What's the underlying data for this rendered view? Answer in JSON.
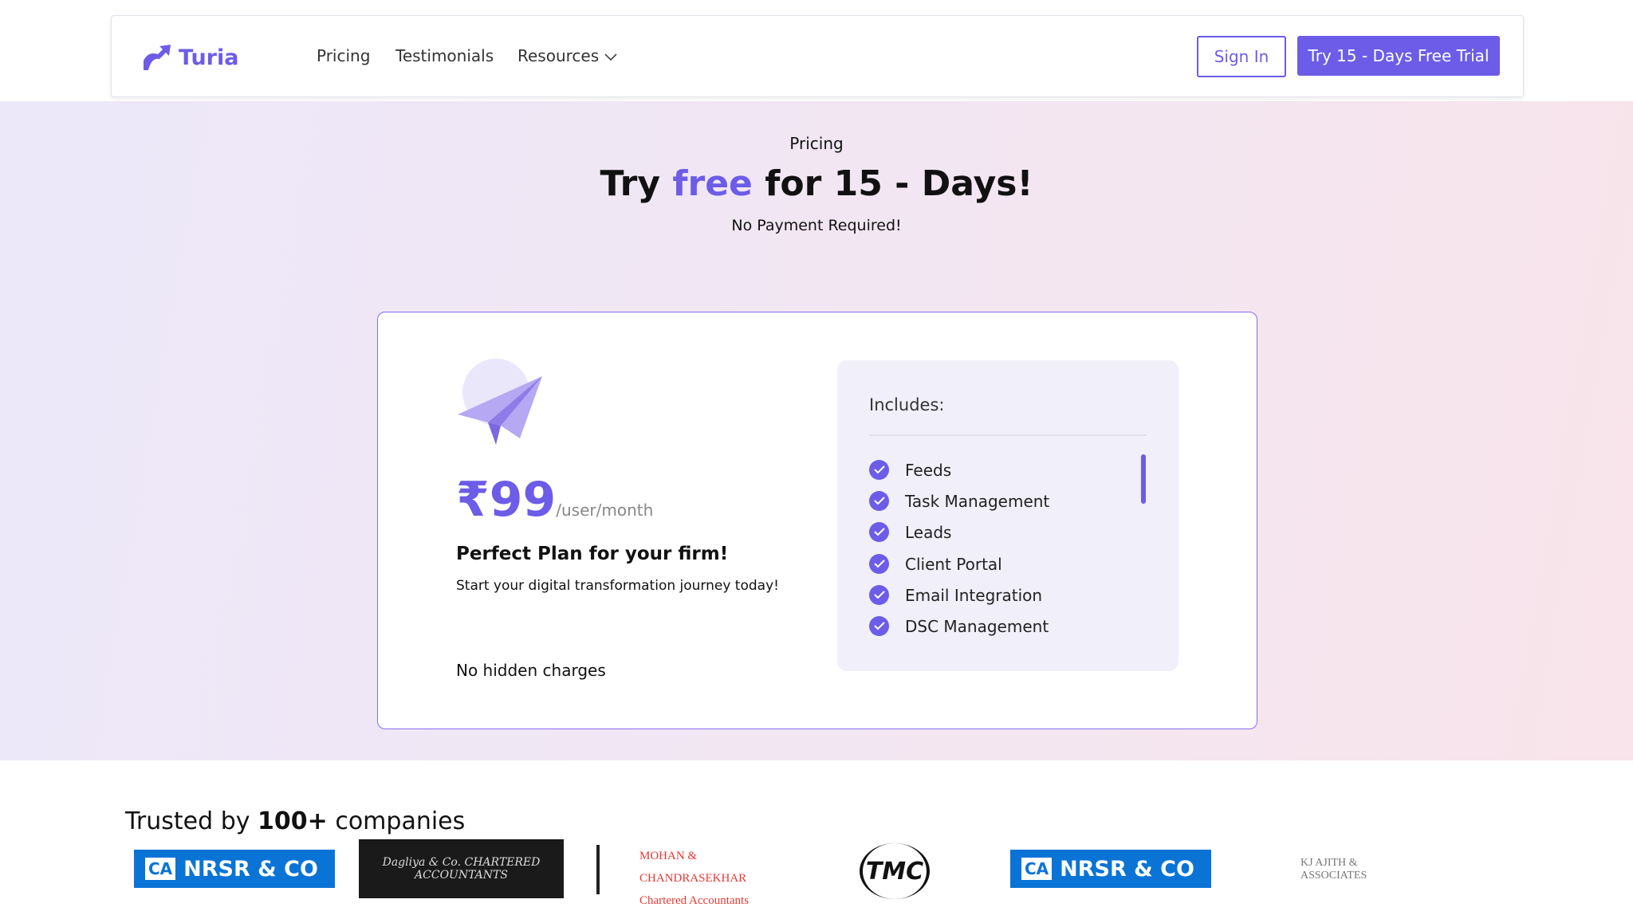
{
  "nav": {
    "brand": "Turia",
    "links": [
      "Pricing",
      "Testimonials",
      "Resources"
    ],
    "sign_in": "Sign In",
    "trial": "Try 15 - Days Free Trial"
  },
  "hero": {
    "eyebrow": "Pricing",
    "title_pre": "Try ",
    "title_accent": "free",
    "title_post": " for 15 - Days!",
    "subtitle": "No Payment Required!"
  },
  "plan": {
    "price": "₹99",
    "unit": "/user/month",
    "name": "Perfect Plan for your firm!",
    "tagline": "Start your digital transformation journey today!",
    "note": "No hidden charges",
    "includes_title": "Includes:",
    "features": [
      "Feeds",
      "Task Management",
      "Leads",
      "Client Portal",
      "Email Integration",
      "DSC Management"
    ]
  },
  "trusted": {
    "pre": "Trusted by ",
    "bold": "100+",
    "post": " companies",
    "logos": [
      "NRSR & CO",
      "Dagliya & Co. CHARTERED ACCOUNTANTS",
      "MOHAN & CHANDRASEKHAR Chartered Accountants",
      "TMC",
      "NRSR & CO",
      "KJ AJITH & ASSOCIATES"
    ]
  },
  "colors": {
    "accent": "#6c5ce7",
    "nrsr_blue": "#0a74d6"
  }
}
